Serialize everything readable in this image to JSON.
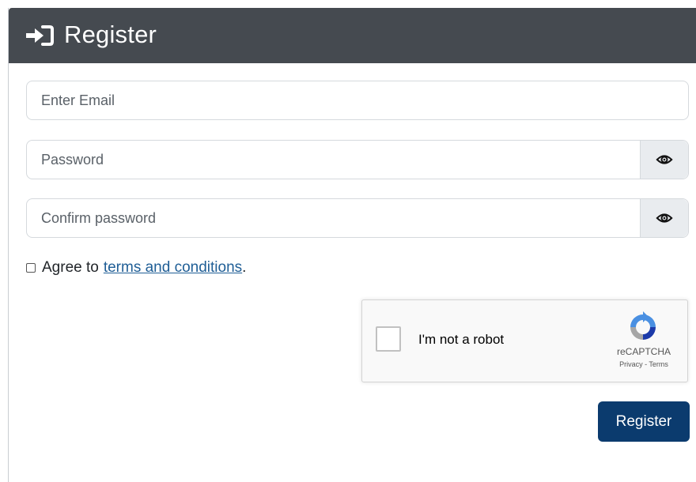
{
  "header": {
    "icon": "sign-in-icon",
    "title": "Register"
  },
  "form": {
    "email": {
      "placeholder": "Enter Email",
      "value": ""
    },
    "password": {
      "placeholder": "Password",
      "value": "",
      "toggle_icon": "eye-icon"
    },
    "confirm_password": {
      "placeholder": "Confirm password",
      "value": "",
      "toggle_icon": "eye-icon"
    },
    "agree": {
      "prefix": "Agree to",
      "link_text": "terms and conditions",
      "suffix": ".",
      "checked": false
    },
    "submit_label": "Register"
  },
  "recaptcha": {
    "label": "I'm not a robot",
    "brand": "reCAPTCHA",
    "links": "Privacy - Terms",
    "checked": false
  },
  "colors": {
    "header_bg": "#454a50",
    "button_bg": "#0b3b6e",
    "link": "#1f5e96"
  }
}
